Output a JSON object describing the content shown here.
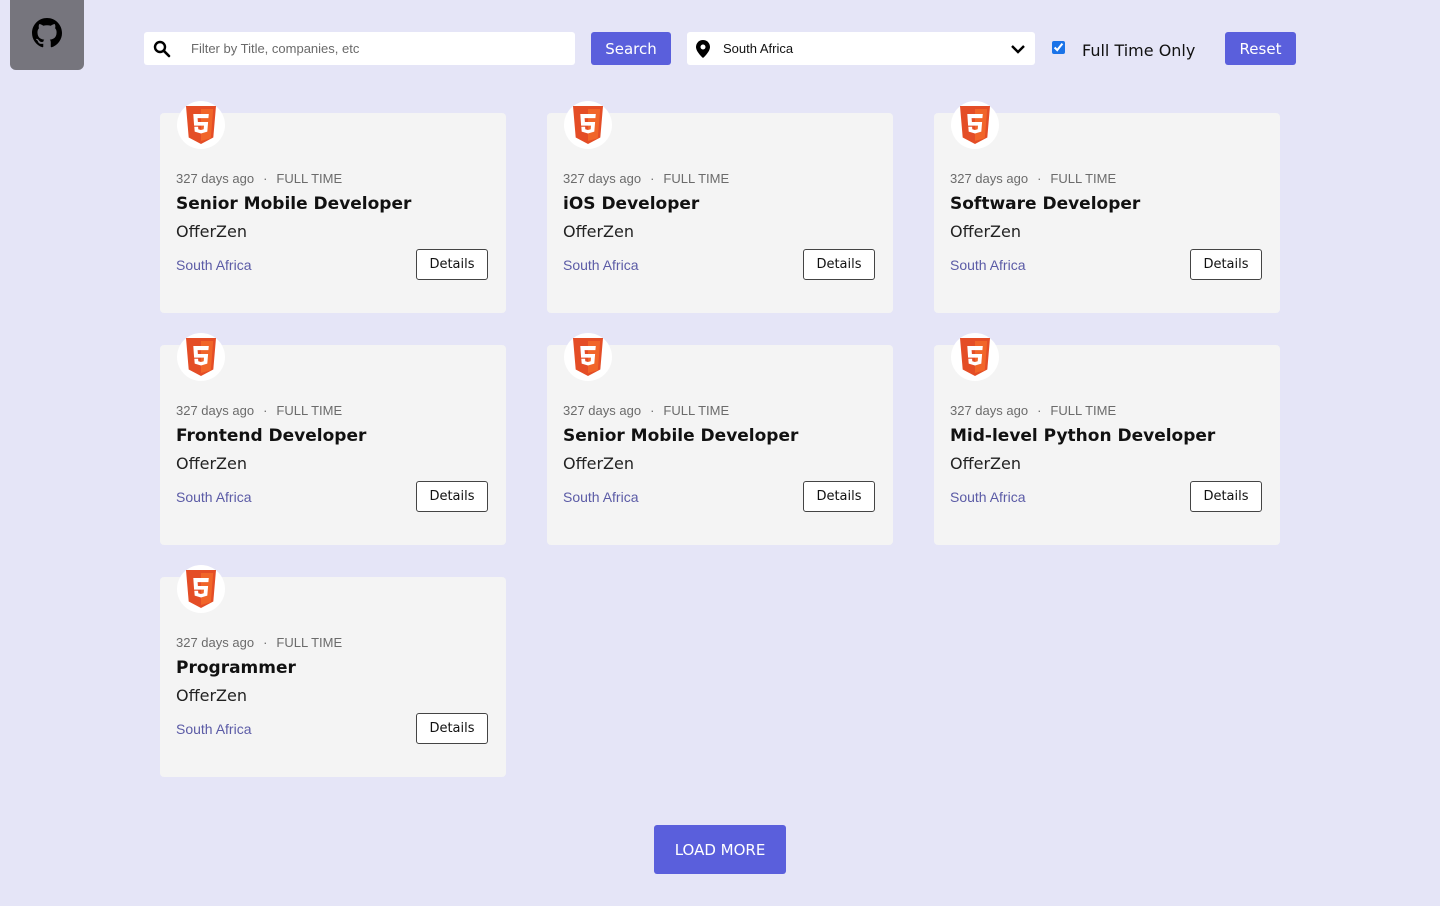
{
  "header": {
    "github_icon": "github-icon",
    "search": {
      "placeholder": "Filter by Title, companies, etc",
      "value": "",
      "button_label": "Search"
    },
    "location": {
      "value": "South Africa"
    },
    "full_time": {
      "label": "Full Time Only",
      "checked": true
    },
    "reset_label": "Reset"
  },
  "jobs": [
    {
      "posted": "327 days ago",
      "type": "FULL TIME",
      "title": "Senior Mobile Developer",
      "company": "OfferZen",
      "location": "South Africa",
      "details_label": "Details",
      "logo": "html5-icon"
    },
    {
      "posted": "327 days ago",
      "type": "FULL TIME",
      "title": "iOS Developer",
      "company": "OfferZen",
      "location": "South Africa",
      "details_label": "Details",
      "logo": "html5-icon"
    },
    {
      "posted": "327 days ago",
      "type": "FULL TIME",
      "title": "Software Developer",
      "company": "OfferZen",
      "location": "South Africa",
      "details_label": "Details",
      "logo": "html5-icon"
    },
    {
      "posted": "327 days ago",
      "type": "FULL TIME",
      "title": "Frontend Developer",
      "company": "OfferZen",
      "location": "South Africa",
      "details_label": "Details",
      "logo": "html5-icon"
    },
    {
      "posted": "327 days ago",
      "type": "FULL TIME",
      "title": "Senior Mobile Developer",
      "company": "OfferZen",
      "location": "South Africa",
      "details_label": "Details",
      "logo": "html5-icon"
    },
    {
      "posted": "327 days ago",
      "type": "FULL TIME",
      "title": "Mid-level Python Developer",
      "company": "OfferZen",
      "location": "South Africa",
      "details_label": "Details",
      "logo": "html5-icon"
    },
    {
      "posted": "327 days ago",
      "type": "FULL TIME",
      "title": "Programmer",
      "company": "OfferZen",
      "location": "South Africa",
      "details_label": "Details",
      "logo": "html5-icon"
    }
  ],
  "load_more_label": "LOAD MORE",
  "colors": {
    "accent": "#5a5fdc",
    "background": "#e5e5f7",
    "card": "#f4f4f4",
    "html5": "#e44d26"
  }
}
